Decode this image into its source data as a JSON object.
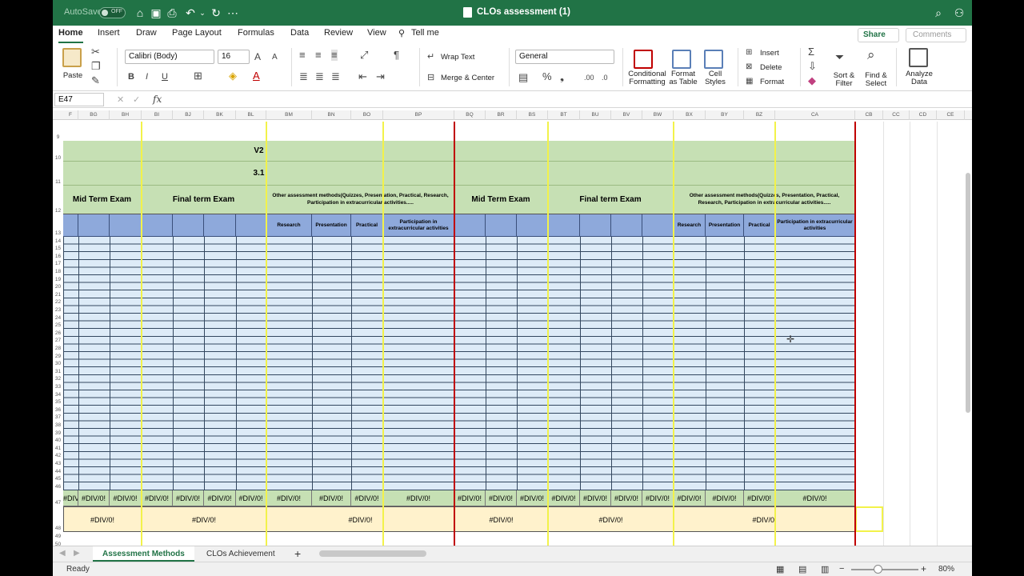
{
  "titlebar": {
    "autosave_label": "AutoSave",
    "autosave_state": "OFF",
    "doc_title": "CLOs assessment (1)"
  },
  "tabs": [
    "Home",
    "Insert",
    "Draw",
    "Page Layout",
    "Formulas",
    "Data",
    "Review",
    "View",
    "Tell me"
  ],
  "share_label": "Share",
  "comments_label": "Comments",
  "ribbon": {
    "paste": "Paste",
    "font_name": "Calibri (Body)",
    "font_size": "16",
    "wrap_text": "Wrap Text",
    "merge_center": "Merge & Center",
    "number_format": "General",
    "conditional_formatting": [
      "Conditional",
      "Formatting"
    ],
    "format_as_table": [
      "Format",
      "as Table"
    ],
    "cell_styles": [
      "Cell",
      "Styles"
    ],
    "insert": "Insert",
    "delete": "Delete",
    "format": "Format",
    "sort_filter": [
      "Sort &",
      "Filter"
    ],
    "find_select": [
      "Find &",
      "Select"
    ],
    "analyze_data": [
      "Analyze",
      "Data"
    ],
    "bold": "B",
    "italic": "I",
    "underline": "U",
    "percent": "%"
  },
  "formula_bar": {
    "name_box": "E47",
    "fx": "fx",
    "value": ""
  },
  "column_headers": [
    "F",
    "BG",
    "BH",
    "BI",
    "BJ",
    "BK",
    "BL",
    "BM",
    "BN",
    "BO",
    "BP",
    "BQ",
    "BR",
    "BS",
    "BT",
    "BU",
    "BV",
    "BW",
    "BX",
    "BY",
    "BZ",
    "CA",
    "CB",
    "CC",
    "CD",
    "CE"
  ],
  "sheet": {
    "v2": "V2",
    "v31": "3.1",
    "mid_term": "Mid Term Exam",
    "final_term": "Final term Exam",
    "other_methods_left": "Other assessment methods(Quizzes, Presentation, Practical, Research, Participation in extracurricular activities.....",
    "other_methods_right": "Other assessment methods(Quizzes, Presentation, Practical, Research, Participation in extracurricular activities.....",
    "research": "Research",
    "presentation": "Presentation",
    "practical": "Practical",
    "participation": "Participation in extracurricular activities",
    "div0": "#DIV/0!",
    "div0_trunc": "#DIV/0!"
  },
  "row_numbers": [
    "9",
    "10",
    "11",
    "12",
    "13",
    "14",
    "15",
    "16",
    "17",
    "18",
    "19",
    "20",
    "21",
    "22",
    "23",
    "24",
    "25",
    "26",
    "27",
    "28",
    "29",
    "30",
    "31",
    "32",
    "33",
    "34",
    "35",
    "36",
    "37",
    "38",
    "39",
    "40",
    "41",
    "42",
    "43",
    "44",
    "45",
    "46",
    "47",
    "48",
    "49",
    "50"
  ],
  "sheet_tabs": [
    "Assessment Methods",
    "CLOs Achievement"
  ],
  "status": {
    "ready": "Ready",
    "zoom": "80%"
  }
}
